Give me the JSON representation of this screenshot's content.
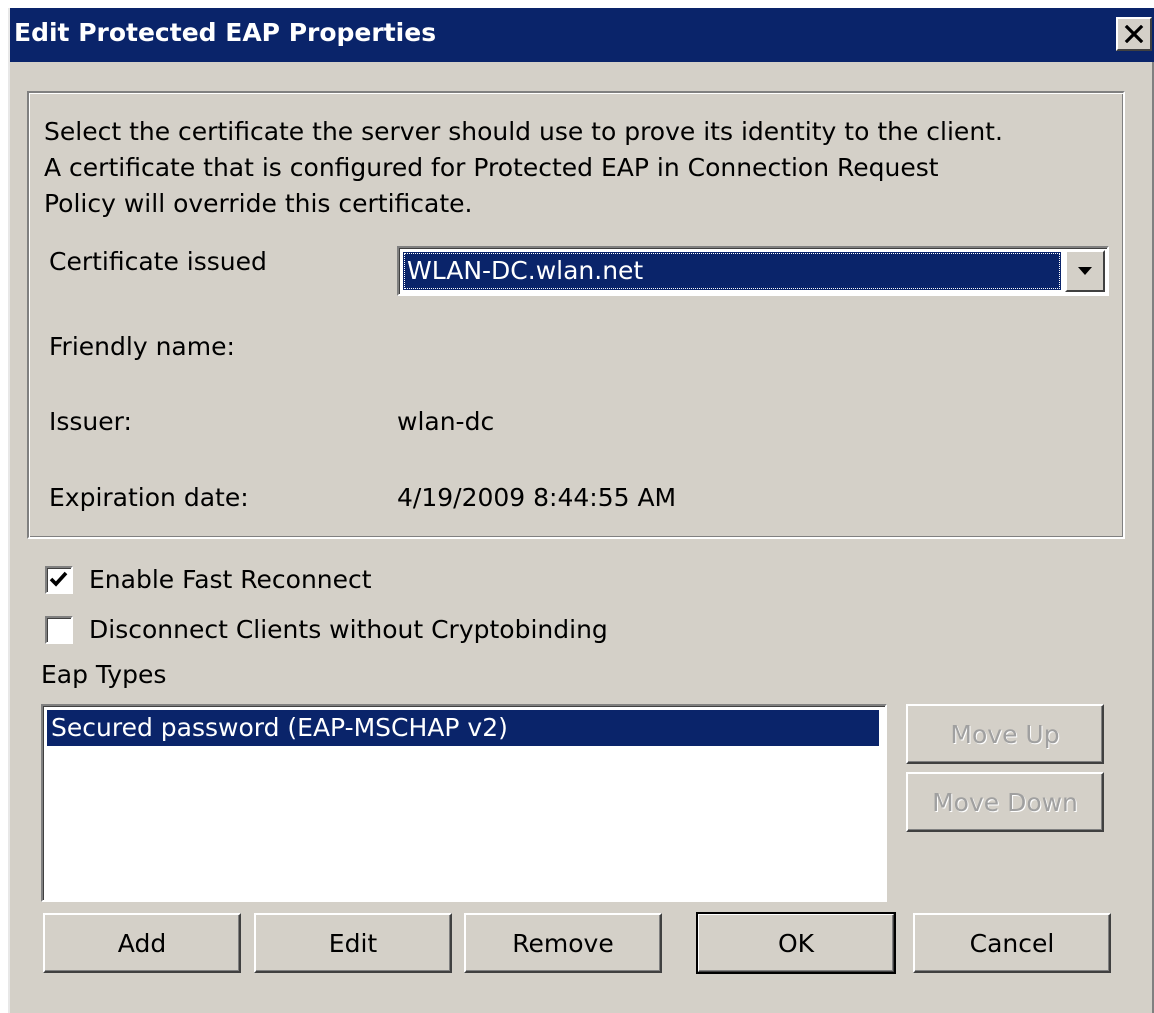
{
  "window": {
    "title": "Edit Protected EAP Properties",
    "close_glyph": "✕"
  },
  "certificate": {
    "description": "Select the certificate the server should use to prove its identity to the client.\nA certificate that is configured for Protected EAP in Connection Request\nPolicy will override this certificate.",
    "issued_label": "Certificate issued",
    "issued_value": "WLAN-DC.wlan.net",
    "friendly_name_label": "Friendly name:",
    "friendly_name_value": "",
    "issuer_label": "Issuer:",
    "issuer_value": "wlan-dc",
    "expiration_label": "Expiration date:",
    "expiration_value": "4/19/2009 8:44:55 AM"
  },
  "options": {
    "fast_reconnect_label": "Enable Fast Reconnect",
    "fast_reconnect_checked": true,
    "cryptobinding_label": "Disconnect Clients without Cryptobinding",
    "cryptobinding_checked": false
  },
  "eap_types": {
    "label": "Eap Types",
    "items": [
      "Secured password (EAP-MSCHAP v2)"
    ],
    "move_up_label": "Move Up",
    "move_down_label": "Move Down"
  },
  "buttons": {
    "add": "Add",
    "edit": "Edit",
    "remove": "Remove",
    "ok": "OK",
    "cancel": "Cancel"
  },
  "colors": {
    "titlebar": "#0a246a",
    "dialog_face": "#d4d0c8",
    "selection": "#0a246a",
    "disabled_text": "#a0a0a0"
  }
}
